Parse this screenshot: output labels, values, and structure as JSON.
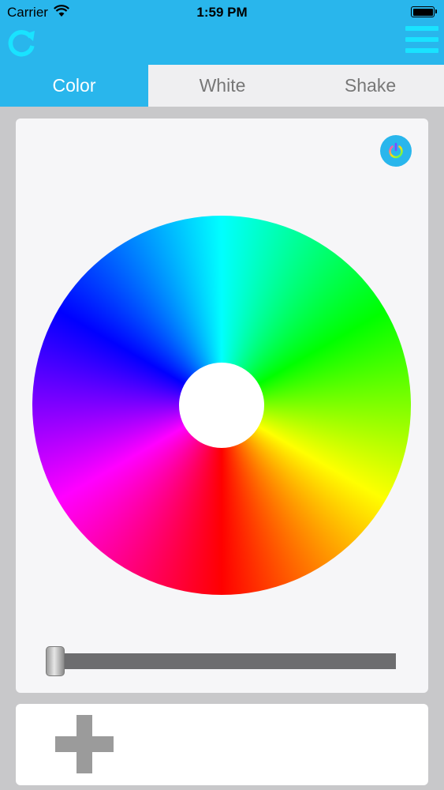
{
  "status_bar": {
    "carrier": "Carrier",
    "time": "1:59 PM",
    "battery_level": 1.0
  },
  "header": {
    "refresh_icon": "refresh-icon",
    "menu_icon": "hamburger-menu-icon"
  },
  "tabs": [
    {
      "label": "Color",
      "active": true
    },
    {
      "label": "White",
      "active": false
    },
    {
      "label": "Shake",
      "active": false
    }
  ],
  "color_panel": {
    "power_icon": "power-icon",
    "brightness_slider_value": 0.0
  },
  "add_panel": {
    "add_icon": "plus-icon"
  },
  "colors": {
    "accent": "#29b6ec",
    "menu_lines": "#19e3ff",
    "background": "#c8c8ca",
    "card": "#f6f6f8",
    "tab_inactive_bg": "#efeff1",
    "slider_track": "#6d6d6f"
  }
}
